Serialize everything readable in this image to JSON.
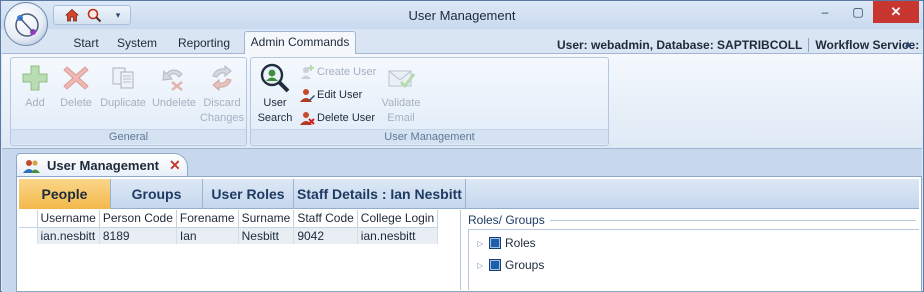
{
  "window": {
    "title": "User Management",
    "close_glyph": "✕",
    "minimize_glyph": "‒",
    "maximize_glyph": "▢"
  },
  "quick_access": {
    "icons": [
      "home-icon",
      "zoom-search-icon"
    ],
    "dropdown_glyph": "▾"
  },
  "ribbon_tabs": [
    {
      "label": "Start"
    },
    {
      "label": "System"
    },
    {
      "label": "Reporting"
    },
    {
      "label": "Admin Commands",
      "active": true
    }
  ],
  "status": {
    "user_db": "User: webadmin, Database: SAPTRIBCOLL",
    "workflow_label": "Workflow Service:",
    "workflow_state_color": "#2f9d27",
    "help_glyph": "?",
    "collapse_glyph": "▲"
  },
  "groups": {
    "general": {
      "label": "General",
      "buttons": [
        {
          "label": "Add",
          "icon": "plus-icon",
          "enabled": false
        },
        {
          "label": "Delete",
          "icon": "x-delete-icon",
          "enabled": false
        },
        {
          "label": "Duplicate",
          "icon": "duplicate-pages-icon",
          "enabled": false
        },
        {
          "label": "Undelete",
          "icon": "undo-arrow-icon",
          "enabled": false
        },
        {
          "label_line1": "Discard",
          "label_line2": "Changes",
          "icon": "refresh-arrows-icon",
          "enabled": false
        }
      ]
    },
    "user_management": {
      "label": "User Management",
      "user_search": {
        "label_line1": "User",
        "label_line2": "Search",
        "icon": "magnifier-user-icon",
        "enabled": true
      },
      "create_user": {
        "label": "Create User",
        "icon": "user-plus-icon",
        "enabled": false
      },
      "edit_user": {
        "label": "Edit User",
        "icon": "user-edit-icon",
        "enabled": true
      },
      "delete_user": {
        "label": "Delete User",
        "icon": "user-delete-icon",
        "enabled": true
      },
      "validate_email": {
        "label_line1": "Validate",
        "label_line2": "Email",
        "icon": "envelope-check-icon",
        "enabled": false
      }
    }
  },
  "document_tab": {
    "label": "User Management",
    "icon": "users-icon",
    "close_glyph": "✕"
  },
  "sub_tabs": [
    {
      "label": "People",
      "active": true
    },
    {
      "label": "Groups"
    },
    {
      "label": "User Roles"
    },
    {
      "label": "Staff Details : Ian Nesbitt"
    }
  ],
  "people_grid": {
    "columns": [
      "Username",
      "Person Code",
      "Forename",
      "Surname",
      "Staff Code",
      "College Login"
    ],
    "rows": [
      [
        "ian.nesbitt",
        "8189",
        "Ian",
        "Nesbitt",
        "9042",
        "ian.nesbitt"
      ]
    ]
  },
  "roles_panel": {
    "title": "Roles/ Groups",
    "nodes": [
      {
        "label": "Roles",
        "expander": "▷"
      },
      {
        "label": "Groups",
        "expander": "▷"
      }
    ]
  }
}
